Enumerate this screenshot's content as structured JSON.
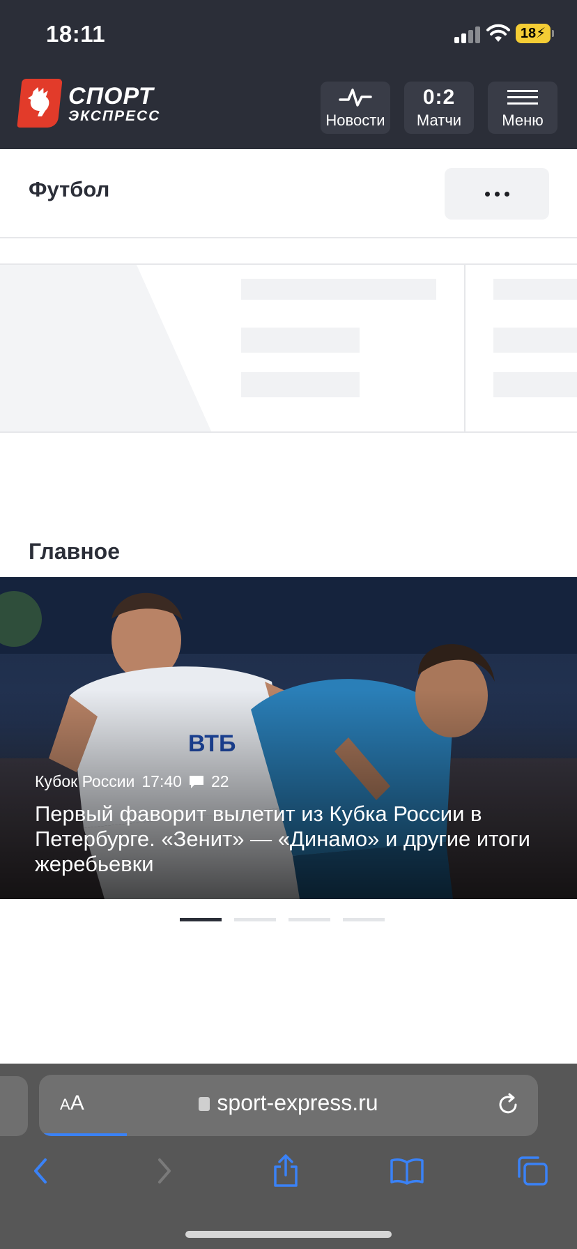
{
  "status_bar": {
    "time": "18:11",
    "battery": "18"
  },
  "header": {
    "logo_title": "СПОРТ",
    "logo_subtitle": "ЭКСПРЕСС",
    "news_label": "Новости",
    "matches_score": "0:2",
    "matches_label": "Матчи",
    "menu_label": "Меню"
  },
  "sport_bar": {
    "title": "Футбол"
  },
  "main": {
    "section_title": "Главное",
    "hero": {
      "category": "Кубок России",
      "time": "17:40",
      "comments": "22",
      "title": "Первый фаворит вылетит из Кубка России в Петербурге. «Зенит» — «Динамо» и другие итоги жеребьевки",
      "slides_total": 4,
      "active_slide": 1
    }
  },
  "browser": {
    "text_size_label": "AA",
    "url": "sport-express.ru"
  },
  "colors": {
    "header_bg": "#2b2e38",
    "logo_red": "#e23b2a",
    "battery_yellow": "#f4cd35",
    "safari_blue": "#3a82f7"
  }
}
